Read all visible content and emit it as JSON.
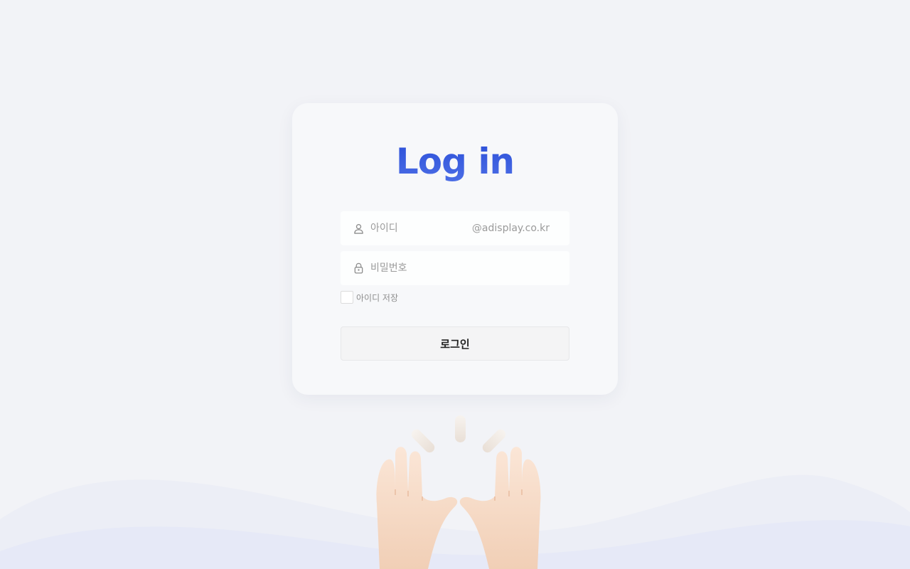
{
  "login": {
    "title": "Log in",
    "id_placeholder": "아이디",
    "domain_suffix": "@adisplay.co.kr",
    "password_placeholder": "비밀번호",
    "remember_label": "아이디 저장",
    "submit_label": "로그인"
  },
  "icons": {
    "id_field": "user-icon",
    "password_field": "lock-icon",
    "illustration": "raised-hands-illustration"
  },
  "colors": {
    "background": "#f2f3f7",
    "title_accent": "#3a5be0",
    "wave_light": "#eceef6",
    "wave_lighter": "#e6e9f7"
  }
}
